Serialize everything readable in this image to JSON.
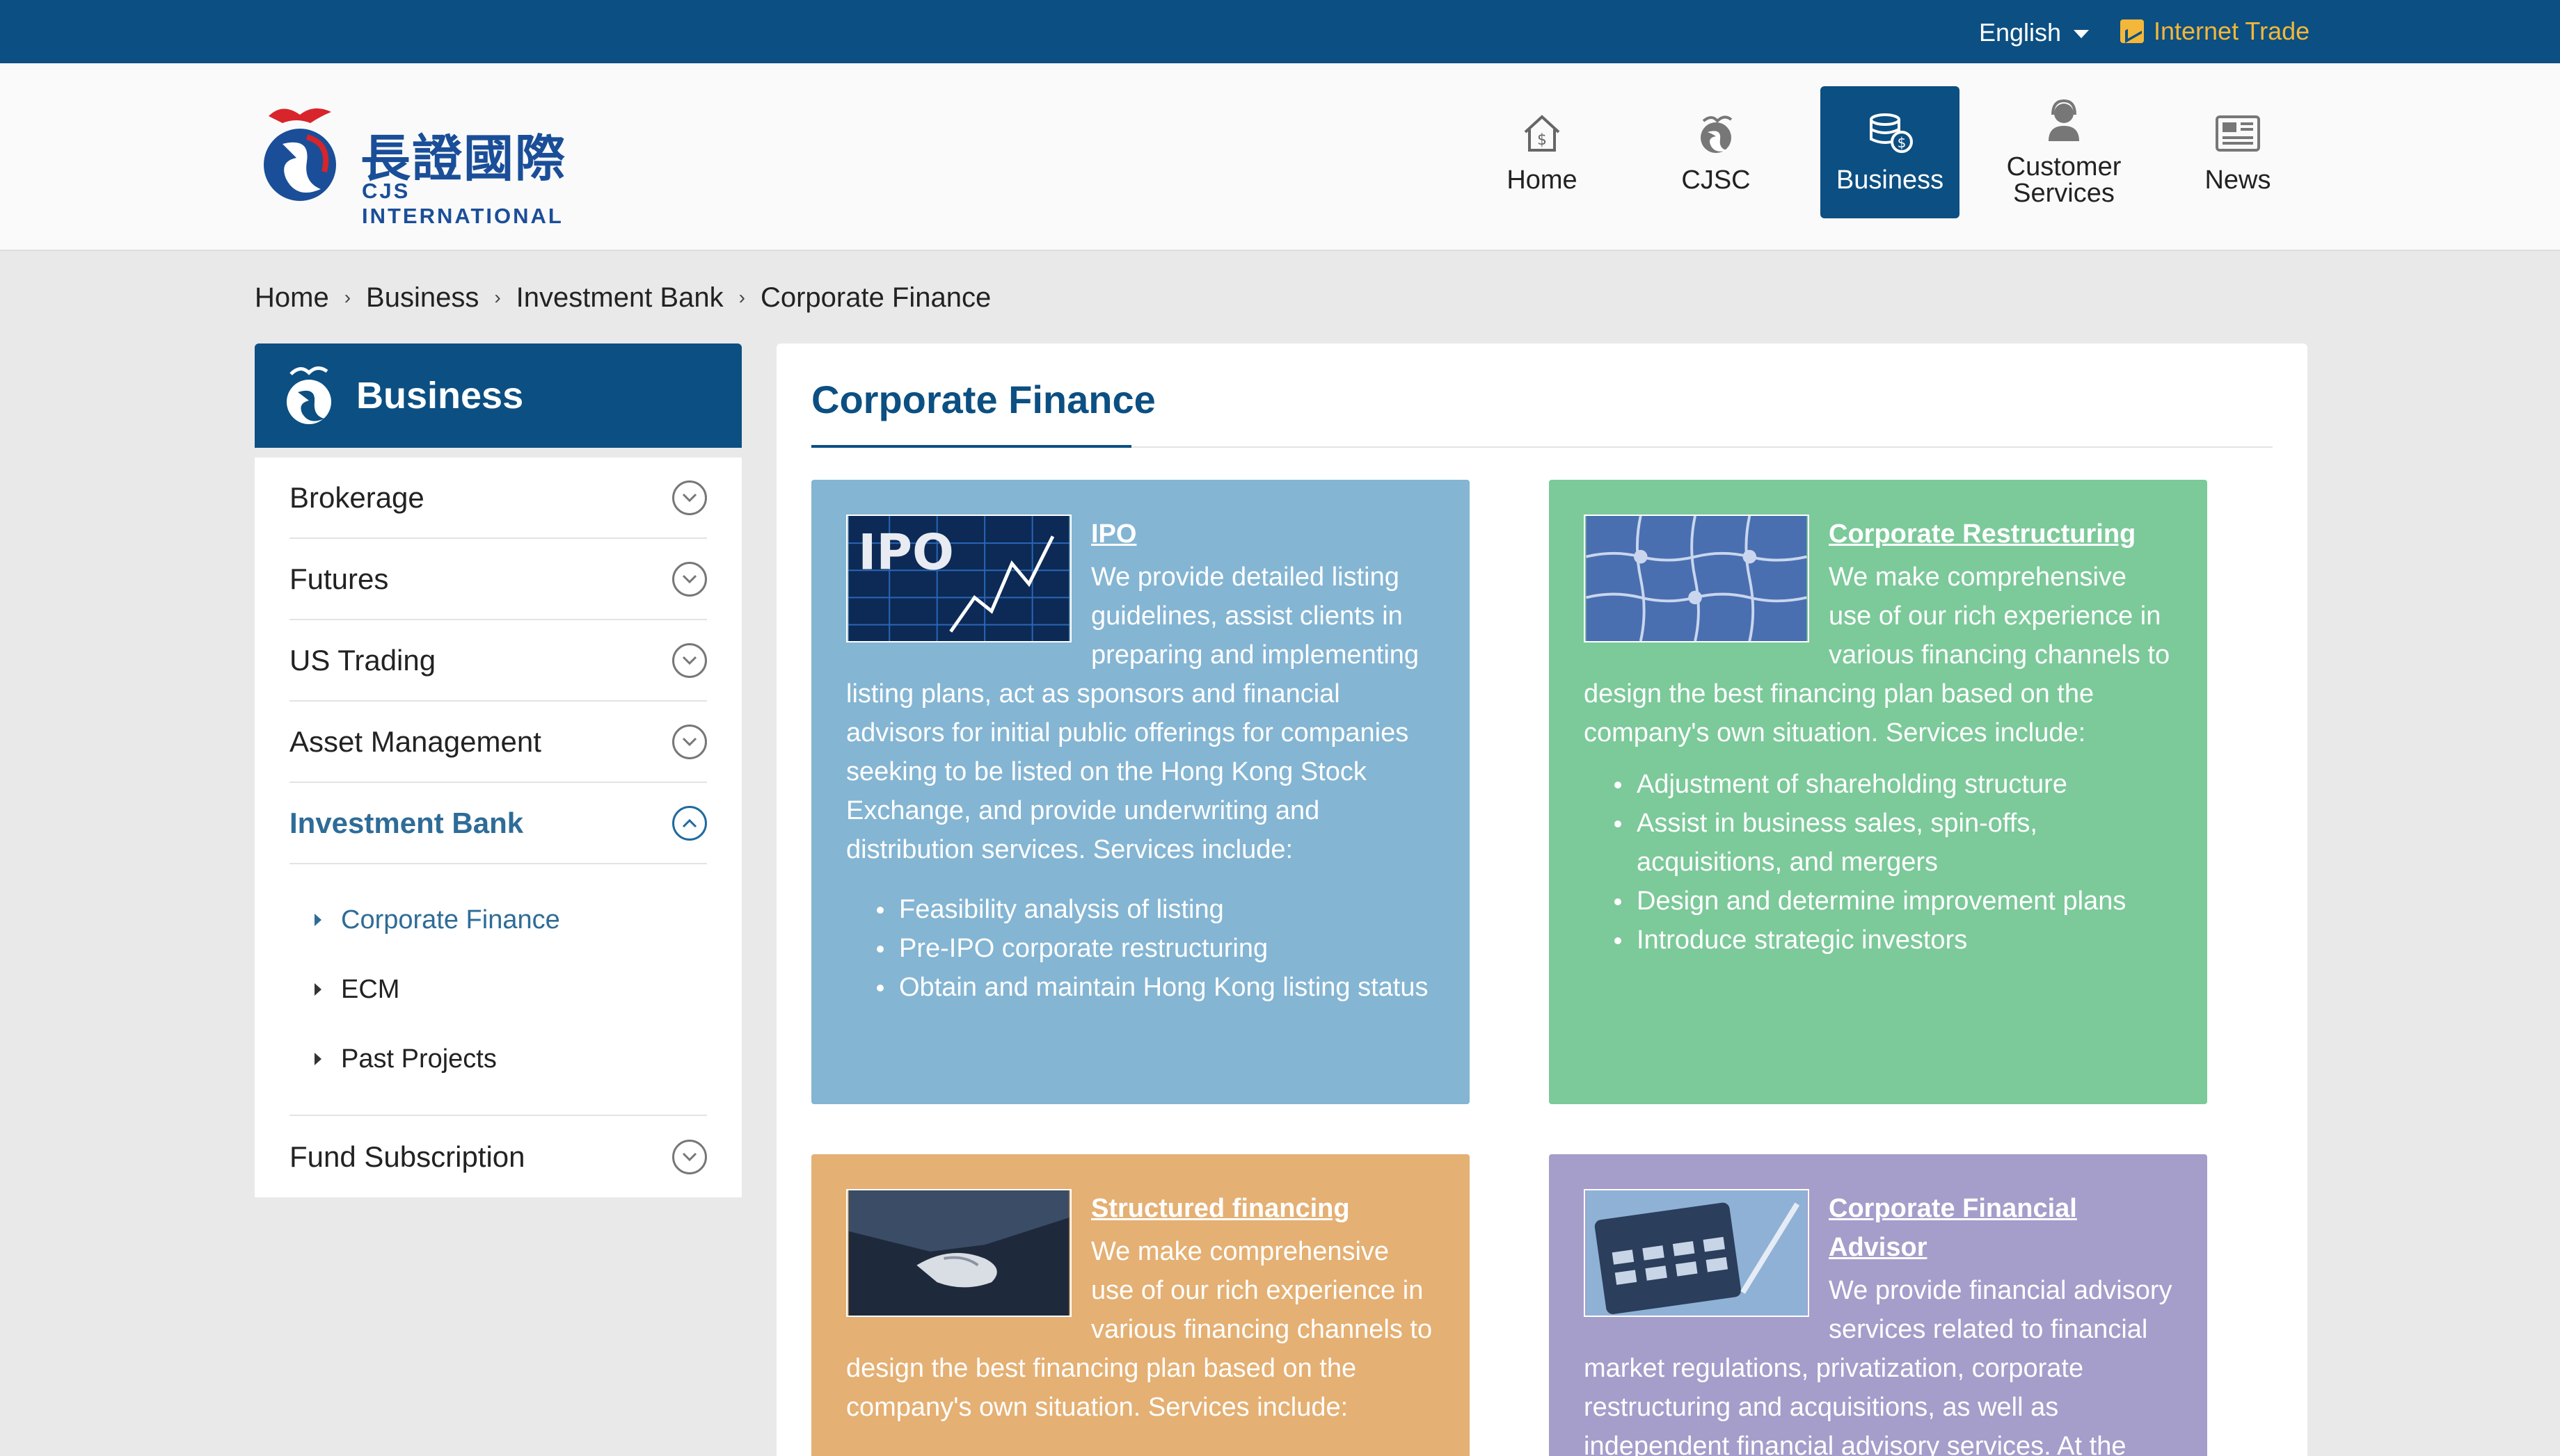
{
  "topbar": {
    "language": "English",
    "internet_trade": "Internet Trade"
  },
  "logo": {
    "chinese_name": "長證國際",
    "english_name": "CJS INTERNATIONAL"
  },
  "nav": {
    "items": [
      {
        "label": "Home"
      },
      {
        "label": "CJSC"
      },
      {
        "label": "Business",
        "active": true
      },
      {
        "label": "Customer Services"
      },
      {
        "label": "News"
      }
    ]
  },
  "breadcrumb": [
    "Home",
    "Business",
    "Investment Bank",
    "Corporate Finance"
  ],
  "sidebar": {
    "title": "Business",
    "items": [
      {
        "label": "Brokerage"
      },
      {
        "label": "Futures"
      },
      {
        "label": "US Trading"
      },
      {
        "label": "Asset Management"
      },
      {
        "label": "Investment Bank",
        "expanded": true
      },
      {
        "label": "Fund Subscription"
      }
    ],
    "sub_items": [
      {
        "label": "Corporate Finance",
        "active": true
      },
      {
        "label": "ECM"
      },
      {
        "label": "Past Projects"
      }
    ]
  },
  "main": {
    "title": "Corporate Finance",
    "cards": [
      {
        "title": "IPO",
        "text": "We provide detailed listing guidelines, assist clients in preparing and implementing listing plans, act as sponsors and financial advisors for initial public offerings for companies seeking to be listed on the Hong Kong Stock Exchange, and provide underwriting and distribution services. Services include:",
        "bullets": [
          "Feasibility analysis of listing",
          "Pre-IPO corporate restructuring",
          "Obtain and maintain Hong Kong listing status"
        ],
        "thumb_text": "IPO"
      },
      {
        "title": "Corporate Restructuring",
        "text": "We make comprehensive use of our rich experience in various financing channels to design the best financing plan based on the company's own situation. Services include:",
        "bullets": [
          "Adjustment of shareholding structure",
          "Assist in business sales, spin-offs, acquisitions, and mergers",
          "Design and determine improvement plans",
          "Introduce strategic investors"
        ]
      },
      {
        "title": "Structured financing",
        "text": "We make comprehensive use of our rich experience in various financing channels to design the best financing plan based on the company's own situation. Services include:",
        "bullets": []
      },
      {
        "title": "Corporate Financial Advisor",
        "text": "We provide financial advisory services related to financial market regulations, privatization, corporate restructuring and acquisitions, as well as independent financial advisory services. At the same time, it provides a",
        "bullets": []
      }
    ]
  },
  "colors": {
    "brand_blue": "#0c4f82",
    "card_blue": "#84b5d3",
    "card_green": "#7cc99a",
    "card_orange": "#e4b073",
    "card_purple": "#a59dca",
    "accent_gold": "#f3b73a"
  }
}
